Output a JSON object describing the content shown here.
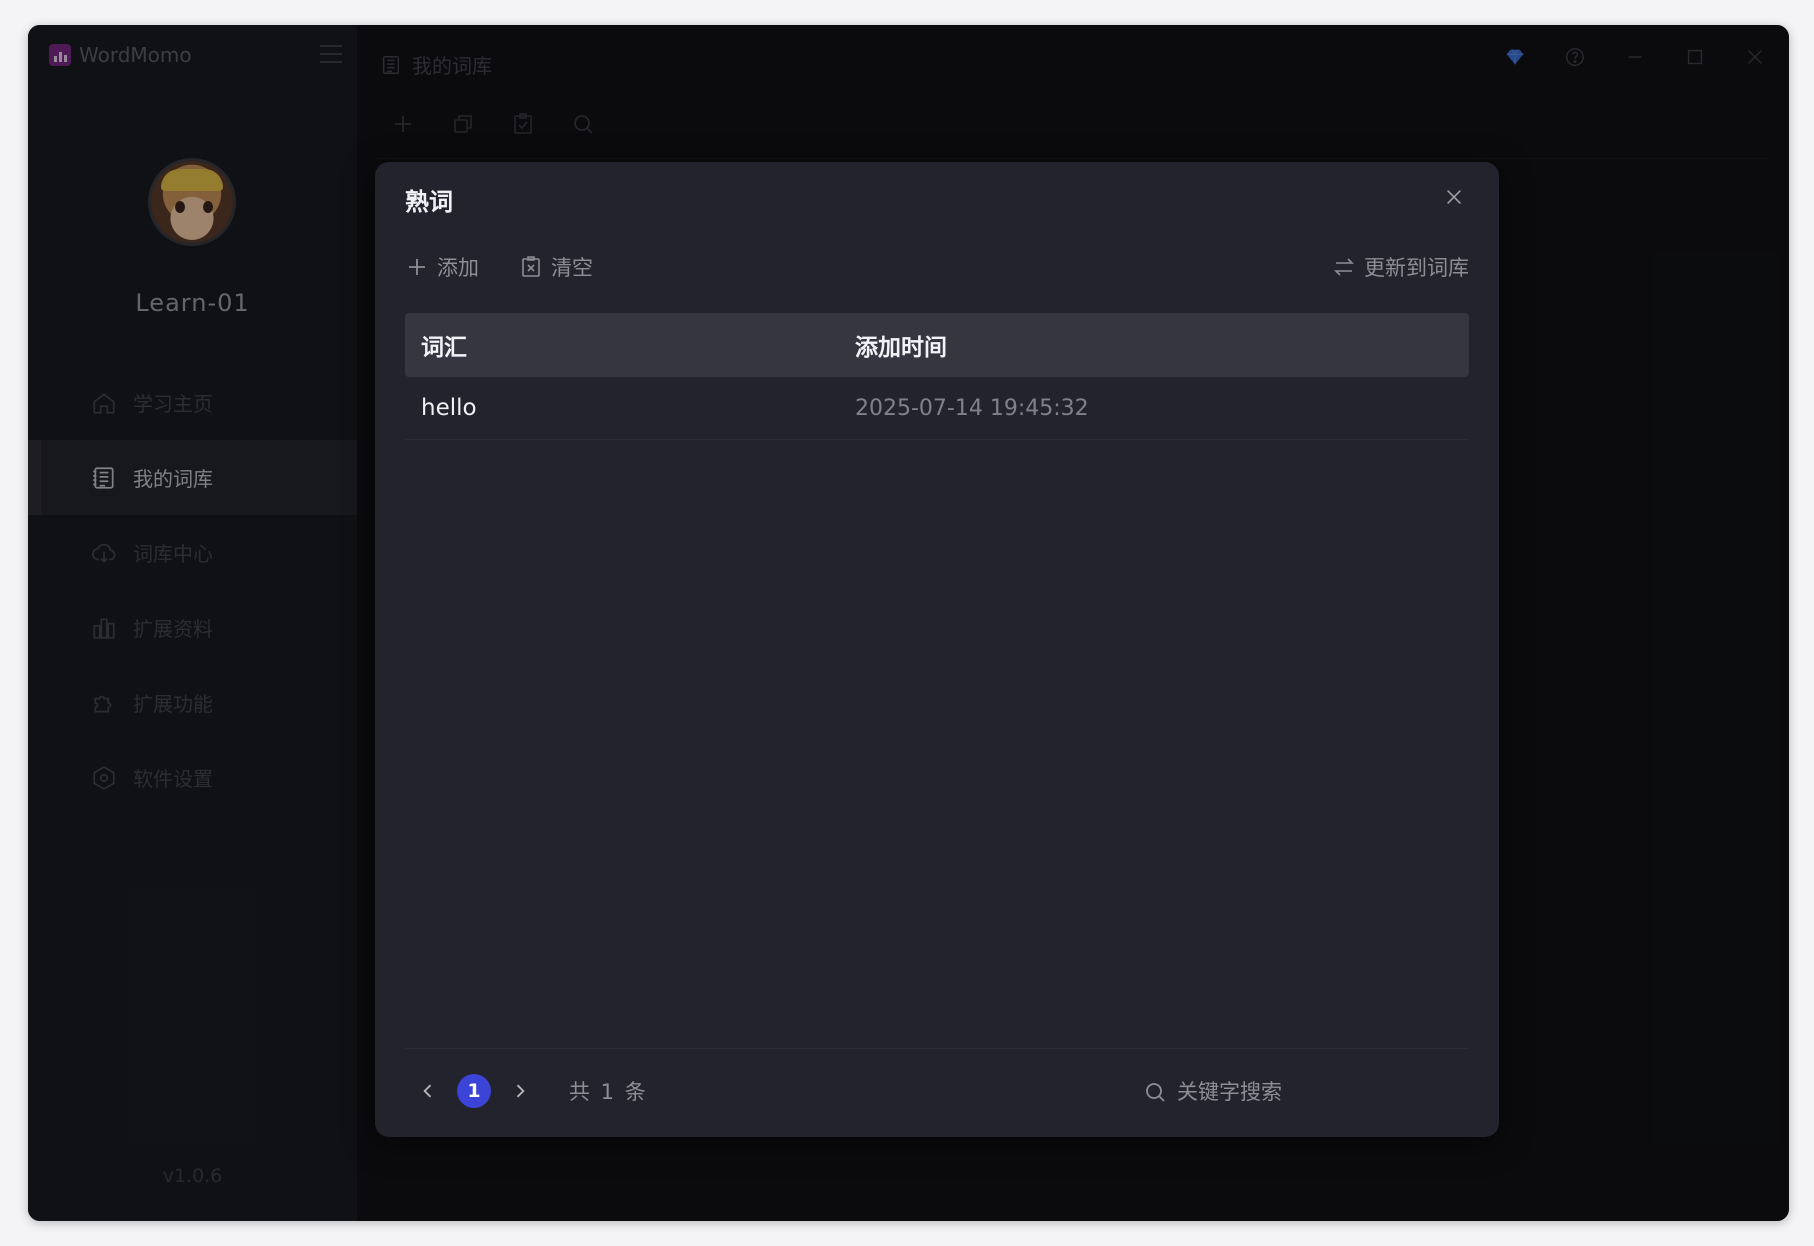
{
  "app": {
    "name": "WordMomo",
    "version": "v1.0.6"
  },
  "user": {
    "name": "Learn-01"
  },
  "sidebar": {
    "items": [
      {
        "label": "学习主页",
        "icon": "home-icon",
        "active": false
      },
      {
        "label": "我的词库",
        "icon": "book-list-icon",
        "active": true
      },
      {
        "label": "词库中心",
        "icon": "cloud-download-icon",
        "active": false
      },
      {
        "label": "扩展资料",
        "icon": "bar-chart-icon",
        "active": false
      },
      {
        "label": "扩展功能",
        "icon": "puzzle-icon",
        "active": false
      },
      {
        "label": "软件设置",
        "icon": "hexagon-gear-icon",
        "active": false
      }
    ]
  },
  "main": {
    "title": "我的词库",
    "toolbar_icons": [
      "plus-icon",
      "copy-icon",
      "clipboard-check-icon",
      "search-icon"
    ]
  },
  "window_controls": [
    "vip-diamond-icon",
    "help-icon",
    "minimize-icon",
    "maximize-icon",
    "close-icon"
  ],
  "dialog": {
    "title": "熟词",
    "actions": {
      "add": "添加",
      "clear": "清空",
      "update": "更新到词库"
    },
    "table": {
      "columns": [
        "词汇",
        "添加时间"
      ],
      "rows": [
        {
          "word": "hello",
          "time": "2025-07-14 19:45:32"
        }
      ]
    },
    "pagination": {
      "current": "1",
      "total_text": "共 1 条"
    },
    "search": {
      "placeholder": "关键字搜索"
    }
  },
  "colors": {
    "accent": "#3b44d6",
    "vip": "#3a6fd8",
    "brand": "#7a2a86"
  }
}
